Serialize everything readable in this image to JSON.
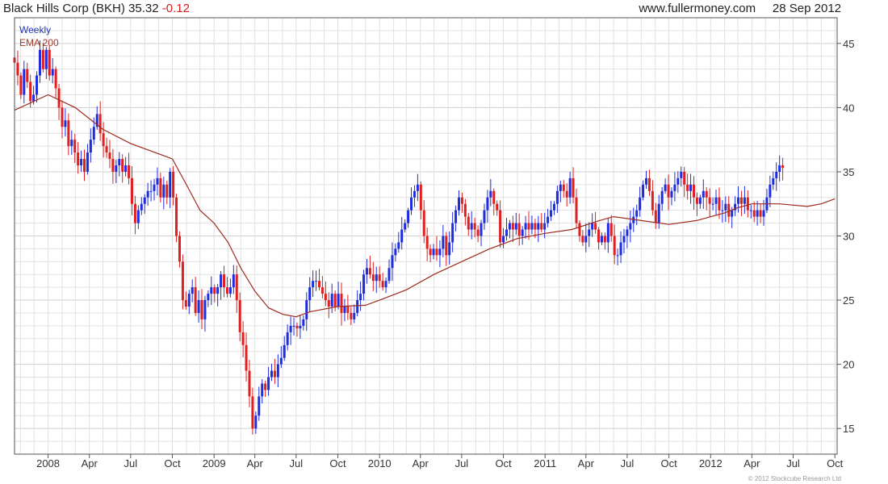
{
  "header": {
    "company": "Black Hills Corp (BKH)",
    "price": "35.32",
    "change": "-0.12",
    "site": "www.fullermoney.com",
    "date": "28 Sep 2012"
  },
  "legend": {
    "series_label": "Weekly",
    "ema_label": "EMA 200"
  },
  "copyright": "© 2012 Stockcube Research Ltd",
  "colors": {
    "up": "#1f2de0",
    "down": "#e02020",
    "ema": "#9e2a1e",
    "grid": "#e0e0e0",
    "grid_major": "#cfcfcf",
    "axis": "#555555"
  },
  "chart_data": {
    "type": "candlestick",
    "frequency": "weekly",
    "title": "Black Hills Corp (BKH) 35.32 -0.12",
    "xlabel": "",
    "ylabel": "",
    "x_range": [
      "2007-10-19",
      "2012-10-06"
    ],
    "ylim": [
      13,
      47
    ],
    "y_ticks": [
      15,
      20,
      25,
      30,
      35,
      40,
      45
    ],
    "x_ticks": [
      {
        "label": "2008",
        "date": "2008-01-01"
      },
      {
        "label": "Apr",
        "date": "2008-04-01"
      },
      {
        "label": "Jul",
        "date": "2008-07-01"
      },
      {
        "label": "Oct",
        "date": "2008-10-01"
      },
      {
        "label": "2009",
        "date": "2009-01-01"
      },
      {
        "label": "Apr",
        "date": "2009-04-01"
      },
      {
        "label": "Jul",
        "date": "2009-07-01"
      },
      {
        "label": "Oct",
        "date": "2009-10-01"
      },
      {
        "label": "2010",
        "date": "2010-01-01"
      },
      {
        "label": "Apr",
        "date": "2010-04-01"
      },
      {
        "label": "Jul",
        "date": "2010-07-01"
      },
      {
        "label": "Oct",
        "date": "2010-10-01"
      },
      {
        "label": "2011",
        "date": "2011-01-01"
      },
      {
        "label": "Apr",
        "date": "2011-04-01"
      },
      {
        "label": "Jul",
        "date": "2011-07-01"
      },
      {
        "label": "Oct",
        "date": "2011-10-01"
      },
      {
        "label": "2012",
        "date": "2012-01-01"
      },
      {
        "label": "Apr",
        "date": "2012-04-01"
      },
      {
        "label": "Jul",
        "date": "2012-07-01"
      },
      {
        "label": "Oct",
        "date": "2012-10-01"
      }
    ],
    "grid": true,
    "last_close": 35.32,
    "change": -0.12,
    "series": [
      {
        "name": "Weekly",
        "kind": "ohlc",
        "start": "2007-10-19",
        "interval_days": 7,
        "closes": [
          43.5,
          42.5,
          41,
          43,
          42,
          40.5,
          41,
          42.5,
          44.5,
          43,
          44.5,
          42.5,
          43,
          41.5,
          40,
          38.5,
          39,
          37,
          37.5,
          36.5,
          35.5,
          36,
          35,
          36.5,
          37.5,
          38.5,
          39.5,
          38,
          37,
          36.5,
          36,
          35,
          35.5,
          36,
          35,
          35.5,
          34.5,
          32.5,
          31,
          32,
          32.5,
          33,
          33.5,
          33.5,
          34,
          34.5,
          33,
          34,
          33,
          35,
          33,
          30,
          28,
          25,
          24.5,
          25.5,
          26,
          24,
          25,
          23.5,
          25,
          25.5,
          26,
          25.5,
          26,
          27,
          26,
          25.5,
          26,
          27,
          25,
          22.5,
          21.5,
          19.5,
          17.5,
          15,
          16,
          17.5,
          18.5,
          18,
          19,
          19.5,
          19,
          20,
          20.5,
          21.5,
          22.5,
          23,
          23,
          22.8,
          23,
          23.5,
          25,
          26,
          26.5,
          26.5,
          26,
          25.5,
          25,
          24.5,
          25.5,
          24.5,
          25.5,
          24,
          24.5,
          24,
          23.5,
          24,
          25,
          25.5,
          27,
          27.5,
          27,
          26.5,
          27,
          26.5,
          26,
          26.5,
          27.5,
          28.5,
          29,
          29.5,
          30.5,
          31,
          32,
          33,
          33.5,
          34,
          32,
          30,
          29,
          28.5,
          29,
          28.5,
          29,
          30,
          28.5,
          29.5,
          31,
          32,
          33,
          32.5,
          31.5,
          30.5,
          31,
          30.5,
          30,
          31,
          32,
          33,
          33.5,
          32.5,
          32,
          29.5,
          30,
          30.5,
          31,
          30.5,
          31,
          30,
          30.5,
          31,
          30.5,
          31,
          30.5,
          31,
          30.5,
          31,
          31.5,
          32,
          32.5,
          33.5,
          34,
          33.5,
          33,
          34.5,
          33,
          31,
          30,
          29.5,
          30,
          30.5,
          31,
          30.5,
          29.5,
          30,
          29.5,
          31,
          30,
          28.5,
          28.5,
          29.5,
          30,
          30.5,
          31,
          31.5,
          32,
          33,
          34,
          34.5,
          33.5,
          32,
          31,
          32.5,
          33.5,
          34,
          33,
          33.5,
          34,
          34.5,
          35,
          34,
          33.5,
          34,
          33,
          32.5,
          33,
          33.5,
          33,
          32.5,
          32.5,
          33,
          32,
          32,
          32.5,
          31.5,
          32,
          32.5,
          33,
          32.5,
          33,
          32,
          32,
          31.5,
          32,
          31.5,
          32,
          33,
          34,
          34.5,
          35,
          35.5,
          35.3
        ]
      },
      {
        "name": "EMA 200",
        "kind": "line",
        "points": [
          [
            "2007-10-19",
            39.8
          ],
          [
            "2008-01-01",
            41
          ],
          [
            "2008-03-01",
            40
          ],
          [
            "2008-05-01",
            38.3
          ],
          [
            "2008-07-01",
            37.2
          ],
          [
            "2008-09-01",
            36.4
          ],
          [
            "2008-10-01",
            36
          ],
          [
            "2008-11-01",
            34
          ],
          [
            "2008-12-01",
            32
          ],
          [
            "2009-01-01",
            31
          ],
          [
            "2009-02-01",
            29.5
          ],
          [
            "2009-03-01",
            27.5
          ],
          [
            "2009-04-01",
            25.7
          ],
          [
            "2009-05-01",
            24.4
          ],
          [
            "2009-06-01",
            23.9
          ],
          [
            "2009-07-01",
            23.7
          ],
          [
            "2009-08-01",
            24.1
          ],
          [
            "2009-10-01",
            24.5
          ],
          [
            "2009-12-01",
            24.6
          ],
          [
            "2010-01-01",
            25
          ],
          [
            "2010-03-01",
            25.8
          ],
          [
            "2010-05-01",
            27
          ],
          [
            "2010-07-01",
            28
          ],
          [
            "2010-09-01",
            29
          ],
          [
            "2010-11-01",
            29.8
          ],
          [
            "2011-01-01",
            30.2
          ],
          [
            "2011-03-01",
            30.5
          ],
          [
            "2011-05-01",
            31.2
          ],
          [
            "2011-06-01",
            31.5
          ],
          [
            "2011-08-01",
            31.2
          ],
          [
            "2011-10-01",
            30.9
          ],
          [
            "2011-12-01",
            31.2
          ],
          [
            "2012-02-01",
            31.8
          ],
          [
            "2012-03-01",
            32.2
          ],
          [
            "2012-04-01",
            32.5
          ],
          [
            "2012-06-01",
            32.5
          ],
          [
            "2012-08-01",
            32.3
          ],
          [
            "2012-09-01",
            32.5
          ],
          [
            "2012-10-01",
            32.9
          ]
        ]
      }
    ]
  }
}
